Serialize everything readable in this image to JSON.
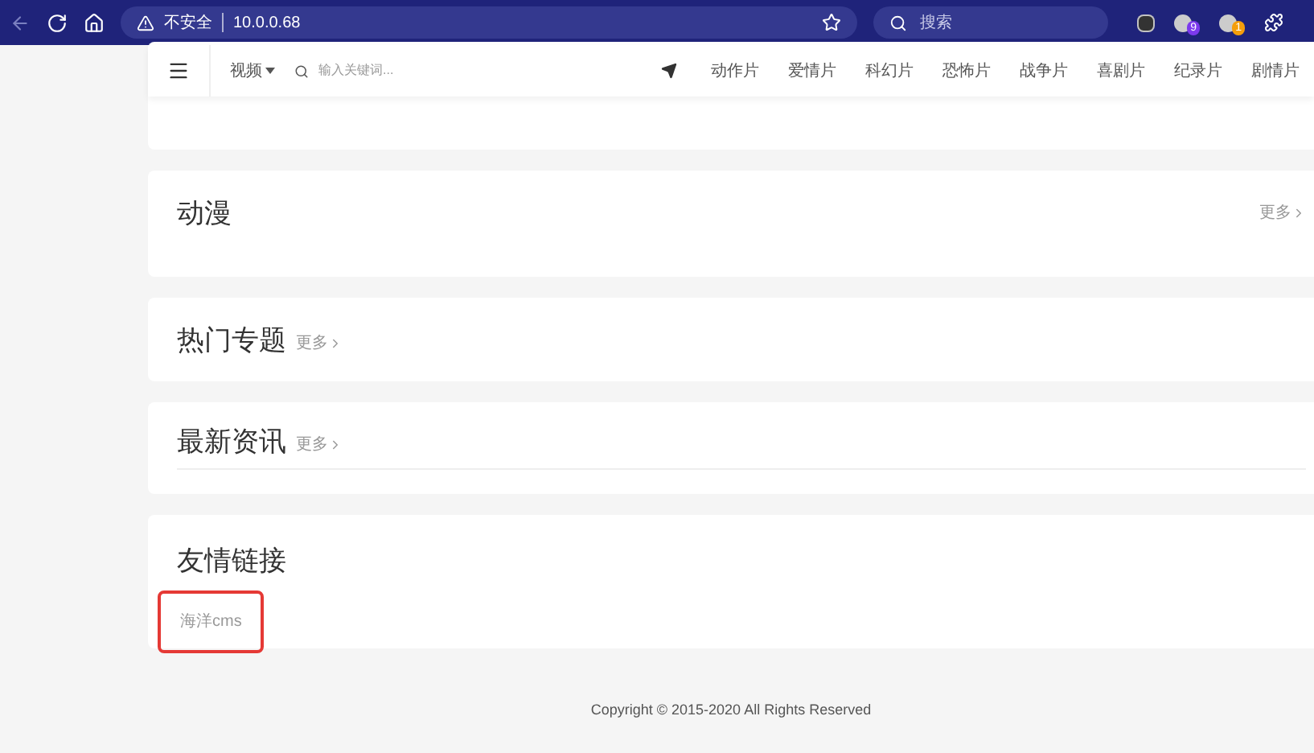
{
  "browser": {
    "security_label": "不安全",
    "url": "10.0.0.68",
    "search_placeholder": "搜索",
    "extension_badges": [
      {
        "text": "9",
        "color": "#7c3aed"
      },
      {
        "text": "1",
        "color": "#f59e0b"
      }
    ]
  },
  "nav": {
    "category": "视频",
    "search_placeholder": "输入关键词...",
    "links": [
      "动作片",
      "爱情片",
      "科幻片",
      "恐怖片",
      "战争片",
      "喜剧片",
      "纪录片",
      "剧情片"
    ]
  },
  "sections": [
    {
      "kind": "covered"
    },
    {
      "title": "动漫",
      "more": "更多",
      "kind": "right_more"
    },
    {
      "title": "热门专题",
      "more": "更多",
      "kind": "inline_more"
    },
    {
      "title": "最新资讯",
      "more": "更多",
      "kind": "ruled"
    },
    {
      "title": "友情链接",
      "kind": "links",
      "links": [
        {
          "text": "海洋cms",
          "highlighted": true
        }
      ]
    }
  ],
  "footer": {
    "copyright": "Copyright © 2015-2020 All Rights Reserved"
  }
}
